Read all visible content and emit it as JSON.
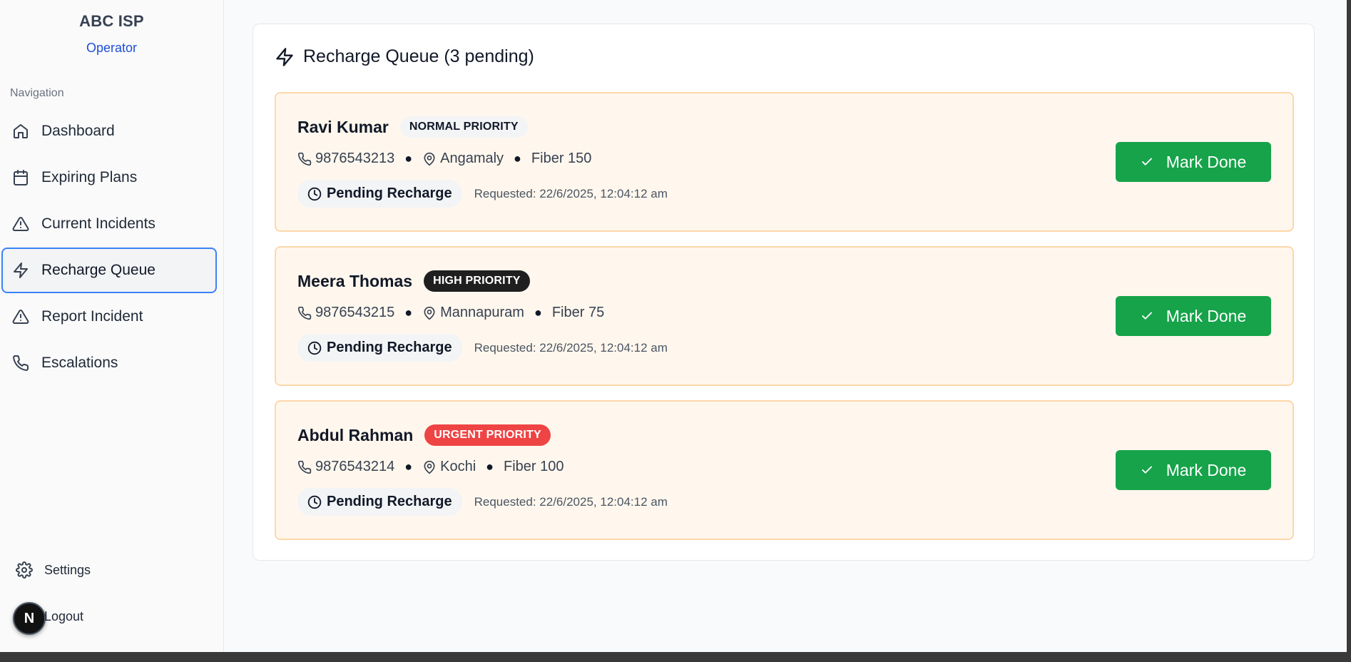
{
  "brand": {
    "name": "ABC ISP",
    "role": "Operator"
  },
  "sidebar": {
    "heading": "Navigation",
    "items": [
      {
        "label": "Dashboard",
        "icon": "home-icon",
        "active": false
      },
      {
        "label": "Expiring Plans",
        "icon": "calendar-icon",
        "active": false
      },
      {
        "label": "Current Incidents",
        "icon": "alert-triangle-icon",
        "active": false
      },
      {
        "label": "Recharge Queue",
        "icon": "zap-icon",
        "active": true
      },
      {
        "label": "Report Incident",
        "icon": "alert-triangle-icon",
        "active": false
      },
      {
        "label": "Escalations",
        "icon": "phone-icon",
        "active": false
      }
    ],
    "settings_label": "Settings",
    "logout_label": "Logout",
    "dev_badge": "N"
  },
  "main": {
    "title": "Recharge Queue (3 pending)",
    "mark_done_label": "Mark Done",
    "pending_label": "Pending Recharge",
    "cards": [
      {
        "name": "Ravi Kumar",
        "priority": "NORMAL PRIORITY",
        "priority_level": "normal",
        "phone": "9876543213",
        "location": "Angamaly",
        "plan": "Fiber 150",
        "requested": "Requested: 22/6/2025, 12:04:12 am"
      },
      {
        "name": "Meera Thomas",
        "priority": "HIGH PRIORITY",
        "priority_level": "high",
        "phone": "9876543215",
        "location": "Mannapuram",
        "plan": "Fiber 75",
        "requested": "Requested: 22/6/2025, 12:04:12 am"
      },
      {
        "name": "Abdul Rahman",
        "priority": "URGENT PRIORITY",
        "priority_level": "urgent",
        "phone": "9876543214",
        "location": "Kochi",
        "plan": "Fiber 100",
        "requested": "Requested: 22/6/2025, 12:04:12 am"
      }
    ]
  },
  "colors": {
    "accent": "#3b82f6",
    "success": "#16a34a",
    "urgent": "#ef4444",
    "card_bg": "#fff7ed",
    "card_border": "#fed7aa"
  }
}
